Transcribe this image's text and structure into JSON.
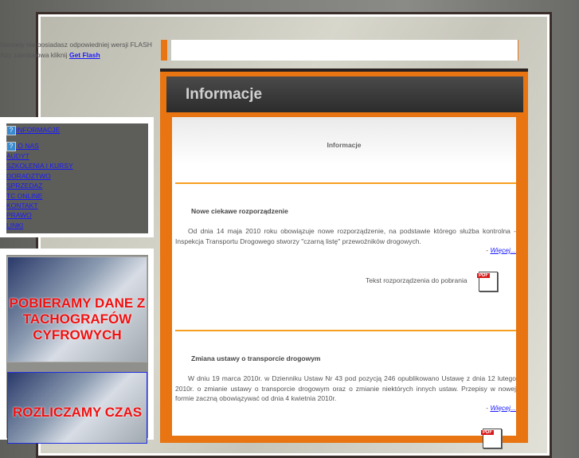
{
  "flash": {
    "line1": "Niestety nie posiadasz odpowiedniej wersji FLASH",
    "line2": "Aby zainstalowa kliknij",
    "link": "Get Flash"
  },
  "header": {
    "title": "Informacje"
  },
  "menu": [
    "INFORMACJE",
    "O NAS",
    "AUDYT",
    "SZKOLENIA I KURSY",
    "DORADZTWO",
    "SPRZEDAZ",
    "TC ONLINE",
    "KONTAKT",
    "PRAWO",
    "LINKI"
  ],
  "banners": [
    "POBIERAMY DANE Z TACHOGRAFÓW CYFROWYCH",
    "ROZLICZAMY CZAS"
  ],
  "content": {
    "title": "Informacje",
    "articles": [
      {
        "heading": "Nowe ciekawe rozporządzenie",
        "text": "Od dnia 14 maja 2010 roku obowiązuje nowe rozporządzenie, na podstawie którego służba kontrolna - Inspekcja Transportu Drogowego stworzy \"czarną listę\" przewoźników drogowych.",
        "more_prefix": "- ",
        "more": "Więcej...",
        "download": "Tekst rozporządzenia do pobrania",
        "pdf_label": "PDF"
      },
      {
        "heading": "Zmiana ustawy o transporcie drogowym",
        "text": "W dniu 19 marca 2010r. w Dzienniku Ustaw Nr 43 pod pozycją 246 opublikowano Ustawę z dnia 12 lutego 2010r. o zmianie ustawy o transporcie drogowym oraz o zmianie niektórych innych ustaw. Przepisy w nowej formie zaczną obowiązywać od dnia 4 kwietnia 2010r.",
        "more_prefix": "- ",
        "more": "Więcej...",
        "pdf_label": "PDF"
      }
    ]
  }
}
